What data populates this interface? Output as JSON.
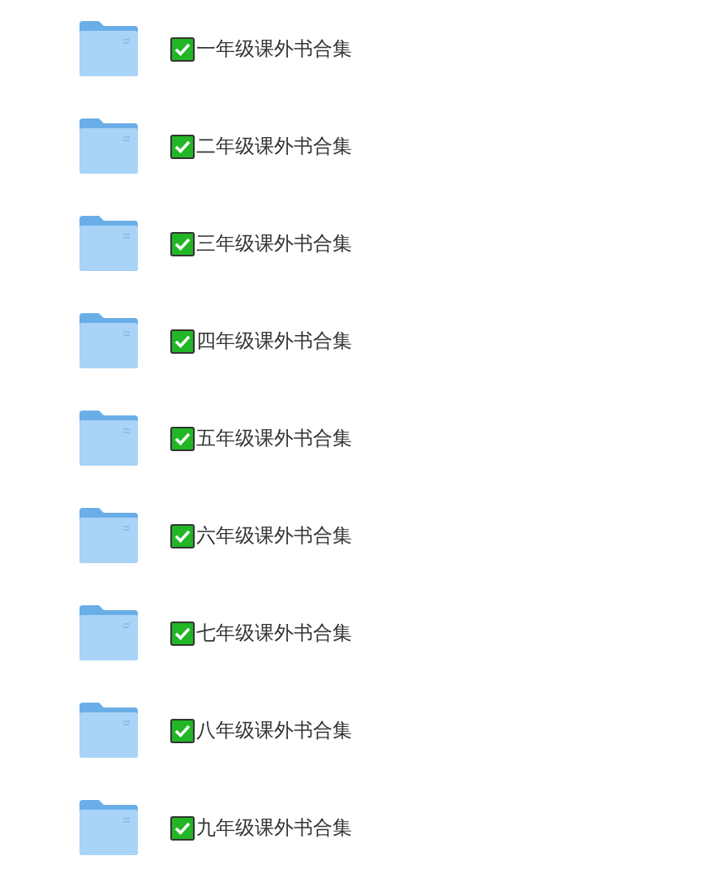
{
  "folders": [
    {
      "name": "一年级课外书合集"
    },
    {
      "name": "二年级课外书合集"
    },
    {
      "name": "三年级课外书合集"
    },
    {
      "name": "四年级课外书合集"
    },
    {
      "name": "五年级课外书合集"
    },
    {
      "name": "六年级课外书合集"
    },
    {
      "name": "七年级课外书合集"
    },
    {
      "name": "八年级课外书合集"
    },
    {
      "name": "九年级课外书合集"
    }
  ]
}
